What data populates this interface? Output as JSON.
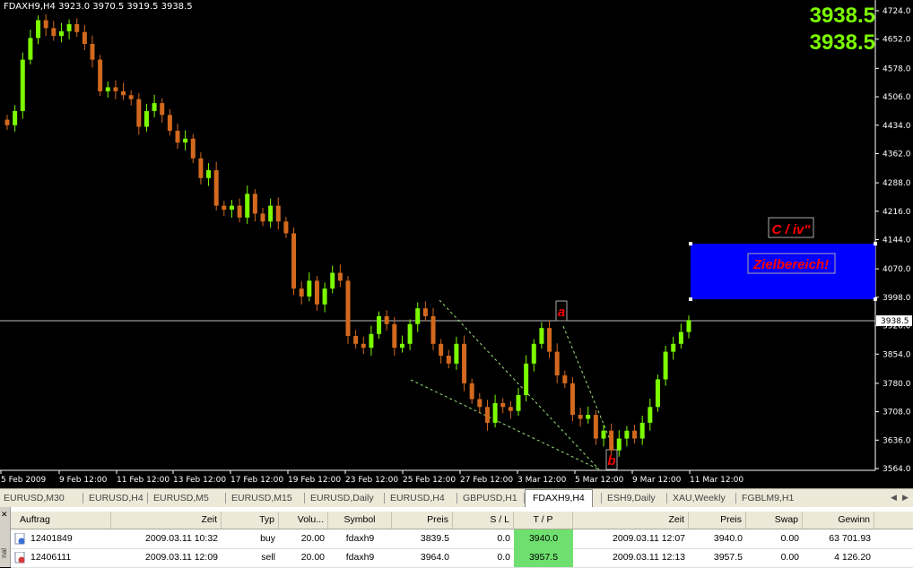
{
  "chart": {
    "title": "FDAXH9,H4  3923.0 3970.5 3919.5 3938.5",
    "bid": "3938.5",
    "ask": "3938.5",
    "price_label": "3938.5",
    "price_axis": [
      "4724.0",
      "4652.0",
      "4578.0",
      "4506.0",
      "4434.0",
      "4362.0",
      "4288.0",
      "4216.0",
      "4144.0",
      "4070.0",
      "3998.0",
      "3926.0",
      "3854.0",
      "3780.0",
      "3708.0",
      "3636.0",
      "3564.0"
    ],
    "time_axis": [
      "5 Feb 2009",
      "9 Feb 12:00",
      "11 Feb 12:00",
      "13 Feb 12:00",
      "17 Feb 12:00",
      "19 Feb 12:00",
      "23 Feb 12:00",
      "25 Feb 12:00",
      "27 Feb 12:00",
      "3 Mar 12:00",
      "5 Mar 12:00",
      "9 Mar 12:00",
      "11 Mar 12:00"
    ],
    "label_a": "a",
    "label_b": "b",
    "label_c": "C / iv\"",
    "target_zone": "Zielbereich!",
    "colors": {
      "bull": "#7cfc00",
      "bear": "#d2691e",
      "zone": "#0000ff",
      "label_red": "#ff0000",
      "bigprice": "#7cfc00"
    }
  },
  "tabs": [
    {
      "label": "EURUSD,M30"
    },
    {
      "label": "EURUSD,H4"
    },
    {
      "label": "EURUSD,M5"
    },
    {
      "label": "EURUSD,M15"
    },
    {
      "label": "EURUSD,Daily"
    },
    {
      "label": "EURUSD,H4"
    },
    {
      "label": "GBPUSD,H1"
    },
    {
      "label": "FDAXH9,H4"
    },
    {
      "label": "ESH9,Daily"
    },
    {
      "label": "XAU,Weekly"
    },
    {
      "label": "FGBLM9,H1"
    }
  ],
  "terminal": {
    "side_label": "nal",
    "columns": [
      "Auftrag",
      "Zeit",
      "Typ",
      "Volu...",
      "Symbol",
      "Preis",
      "S / L",
      "T / P",
      "Zeit",
      "Preis",
      "Swap",
      "Gewinn"
    ],
    "rows": [
      [
        "12401849",
        "2009.03.11 10:32",
        "buy",
        "20.00",
        "fdaxh9",
        "3839.5",
        "0.0",
        "3940.0",
        "2009.03.11 12:07",
        "3940.0",
        "0.00",
        "63 701.93"
      ],
      [
        "12406111",
        "2009.03.11 12:09",
        "sell",
        "20.00",
        "fdaxh9",
        "3964.0",
        "0.0",
        "3957.5",
        "2009.03.11 12:13",
        "3957.5",
        "0.00",
        "4 126.20"
      ]
    ]
  }
}
